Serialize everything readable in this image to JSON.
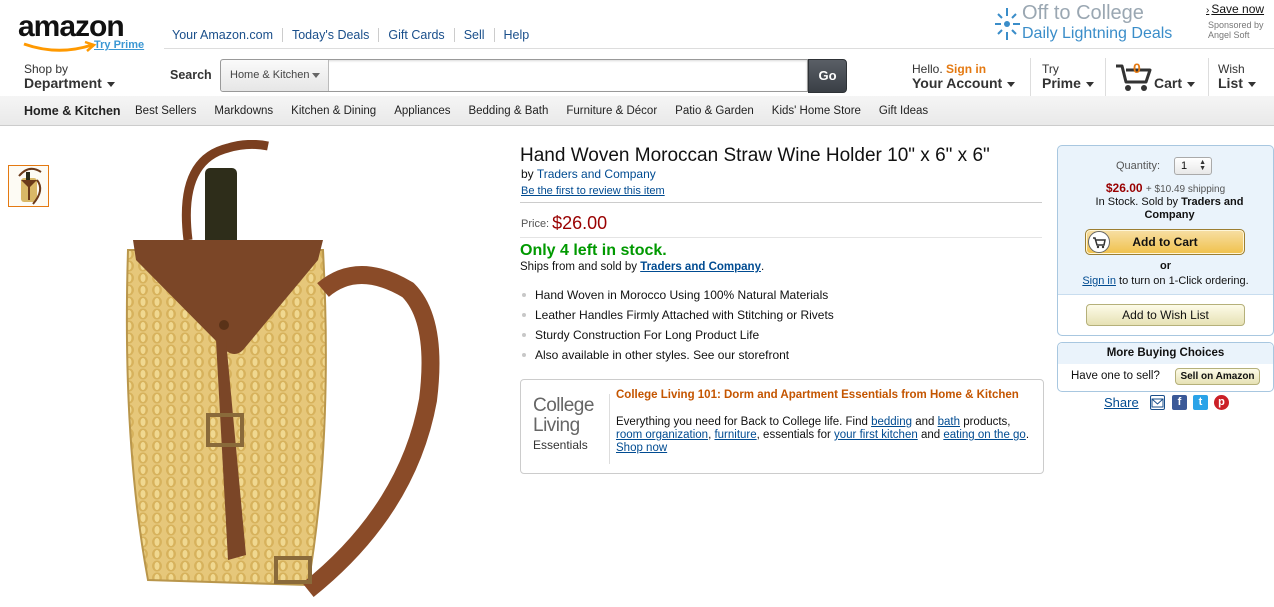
{
  "header": {
    "logo_text": "amazon",
    "logo_sub": "Try Prime",
    "top_links": [
      "Your Amazon.com",
      "Today's Deals",
      "Gift Cards",
      "Sell",
      "Help"
    ],
    "promo_line1": "Off to College",
    "promo_line2": "Daily Lightning Deals",
    "save_now": "Save now",
    "sponsored": "Sponsored by Angel Soft",
    "shop_by": "Shop by",
    "department": "Department",
    "search_label": "Search",
    "search_category": "Home & Kitchen",
    "search_value": "",
    "go_label": "Go",
    "hello": "Hello.",
    "sign_in": "Sign in",
    "your_account": "Your Account",
    "try": "Try",
    "prime": "Prime",
    "cart_count": "0",
    "cart_label": "Cart",
    "wish": "Wish",
    "list": "List"
  },
  "subnav": {
    "category": "Home & Kitchen",
    "items": [
      "Best Sellers",
      "Markdowns",
      "Kitchen & Dining",
      "Appliances",
      "Bedding & Bath",
      "Furniture & Décor",
      "Patio & Garden",
      "Kids' Home Store",
      "Gift Ideas"
    ]
  },
  "product": {
    "title": "Hand Woven Moroccan Straw Wine Holder 10\" x 6\" x 6\"",
    "by": "by",
    "brand": "Traders and Company",
    "review_link": "Be the first to review this item",
    "price_label": "Price:",
    "price": "$26.00",
    "stock": "Only 4 left in stock.",
    "ships_prefix": "Ships from and sold by",
    "seller": "Traders and Company",
    "ships_suffix": ".",
    "bullets": [
      "Hand Woven in Morocco Using 100% Natural Materials",
      "Leather Handles Firmly Attached with Stitching or Rivets",
      "Sturdy Construction For Long Product Life",
      "Also available in other styles. See our storefront"
    ]
  },
  "college": {
    "logo1": "College",
    "logo2": "Living",
    "logo3": "Essentials",
    "headline": "College Living 101: Dorm and Apartment Essentials from Home & Kitchen",
    "t1": "Everything you need for Back to College life. Find",
    "l1": "bedding",
    "t2": "and",
    "l2": "bath",
    "t3": "products,",
    "l3": "room organization",
    "t4": ",",
    "l4": "furniture",
    "t5": ", essentials for",
    "l5": "your first kitchen",
    "t6": "and",
    "l6": "eating on the go",
    "t7": ".",
    "l7": "Shop now"
  },
  "buybox": {
    "quantity_label": "Quantity:",
    "quantity_value": "1",
    "price": "$26.00",
    "shipping": "+ $10.49 shipping",
    "instock": "In Stock. Sold by",
    "seller": "Traders and Company",
    "add_to_cart": "Add to Cart",
    "or": "or",
    "sign_in": "Sign in",
    "oneclick": "to turn on 1-Click ordering.",
    "wish_list": "Add to Wish List"
  },
  "more": {
    "heading": "More Buying Choices",
    "question": "Have one to sell?",
    "sell_button": "Sell on Amazon"
  },
  "share": {
    "label": "Share"
  },
  "colors": {
    "accent": "#e47911",
    "link": "#004b91",
    "price": "#990000",
    "stock": "#009900"
  }
}
